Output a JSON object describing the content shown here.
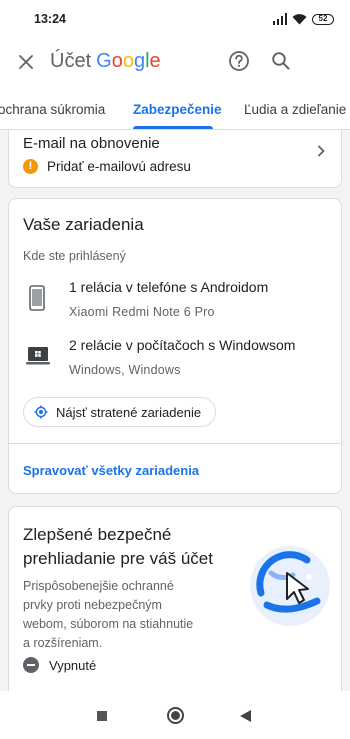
{
  "status_bar": {
    "time": "13:24",
    "battery": "52"
  },
  "app_bar": {
    "title_prefix": "Účet",
    "brand": [
      {
        "ch": "G",
        "color": "#4285F4"
      },
      {
        "ch": "o",
        "color": "#EA4335"
      },
      {
        "ch": "o",
        "color": "#FBBC05"
      },
      {
        "ch": "g",
        "color": "#4285F4"
      },
      {
        "ch": "l",
        "color": "#34A853"
      },
      {
        "ch": "e",
        "color": "#EA4335"
      }
    ]
  },
  "tabs": {
    "left": "ochrana súkromia",
    "active": "Zabezpečenie",
    "right": "Ľudia a zdieľanie"
  },
  "recovery_email": {
    "title": "E-mail na obnovenie",
    "warning_icon": "!",
    "action": "Pridať e-mailovú adresu"
  },
  "devices": {
    "heading": "Vaše zariadenia",
    "subheading": "Kde ste prihlásený",
    "items": [
      {
        "icon": "phone-icon",
        "title": "1 relácia v telefóne s Androidom",
        "meta": "Xiaomi Redmi Note 6 Pro"
      },
      {
        "icon": "laptop-icon",
        "title": "2 relácie v počítačoch s Windowsom",
        "meta": "Windows, Windows"
      }
    ],
    "find_button": "Nájsť stratené zariadenie",
    "manage_link": "Spravovať všetky zariadenia"
  },
  "safe_browsing": {
    "heading": "Zlepšené bezpečné prehliadanie pre váš účet",
    "description": "Prispôsobenejšie ochranné prvky proti nebezpečným webom, súborom na stiahnutie a rozšíreniam.",
    "status": "Vypnuté"
  },
  "colors": {
    "accent": "#1a73e8",
    "warning": "#f29900",
    "text_secondary": "#5f6368"
  }
}
